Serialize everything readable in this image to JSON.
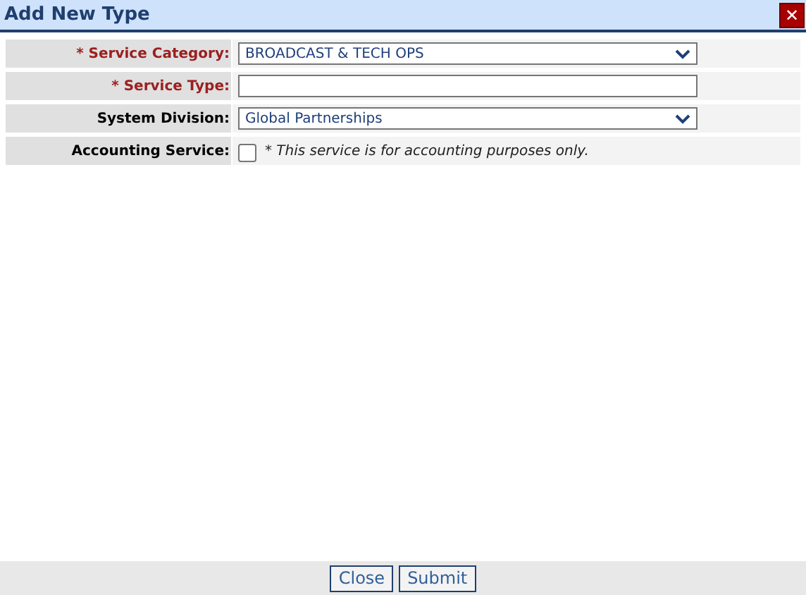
{
  "window": {
    "title": "Add New Type",
    "close": "✕"
  },
  "fields": [
    {
      "kind": "select",
      "label": "* Service Category:",
      "required": true,
      "value": "BROADCAST & TECH OPS"
    },
    {
      "kind": "text",
      "label": "* Service Type:",
      "required": true
    },
    {
      "kind": "select",
      "label": "System Division:",
      "required": false,
      "value": "Global Partnerships"
    },
    {
      "kind": "checkbox",
      "label": "Accounting Service:",
      "required": false,
      "checked": false,
      "note": "* This service is for accounting purposes only."
    }
  ],
  "buttons": [
    "Close",
    "Submit"
  ]
}
